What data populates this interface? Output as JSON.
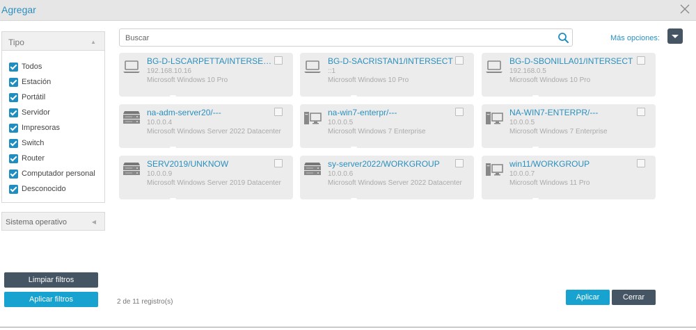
{
  "window": {
    "title": "Agregar"
  },
  "filters": {
    "tipo_label": "Tipo",
    "items": [
      {
        "label": "Todos",
        "checked": true
      },
      {
        "label": "Estación",
        "checked": true
      },
      {
        "label": "Portátil",
        "checked": true
      },
      {
        "label": "Servidor",
        "checked": true
      },
      {
        "label": "Impresoras",
        "checked": true
      },
      {
        "label": "Switch",
        "checked": true
      },
      {
        "label": "Router",
        "checked": true
      },
      {
        "label": "Computador personal",
        "checked": true
      },
      {
        "label": "Desconocido",
        "checked": true
      }
    ],
    "so_label": "Sistema operativo",
    "clear_label": "Limpiar filtros",
    "apply_label": "Aplicar filtros"
  },
  "search": {
    "placeholder": "Buscar"
  },
  "more_options_label": "Más opciones:",
  "devices": [
    {
      "name": "BG-D-LSCARPETTA/INTERSECT",
      "ip": "192.168.10.16",
      "os": "Microsoft Windows 10 Pro",
      "icon": "laptop-icon"
    },
    {
      "name": "BG-D-SACRISTAN1/INTERSECT",
      "ip": "::1",
      "os": "Microsoft Windows 10 Pro",
      "icon": "laptop-icon"
    },
    {
      "name": "BG-D-SBONILLA01/INTERSECT",
      "ip": "192.168.0.5",
      "os": "Microsoft Windows 10 Pro",
      "icon": "laptop-icon"
    },
    {
      "name": "na-adm-server20/---",
      "ip": "10.0.0.4",
      "os": "Microsoft Windows Server 2022 Datacenter",
      "icon": "server-icon"
    },
    {
      "name": "na-win7-enterpr/---",
      "ip": "10.0.0.5",
      "os": "Microsoft Windows 7 Enterprise",
      "icon": "desktop-icon"
    },
    {
      "name": "NA-WIN7-ENTERPR/---",
      "ip": "10.0.0.5",
      "os": "Microsoft Windows 7 Enterprise",
      "icon": "desktop-icon"
    },
    {
      "name": "SERV2019/UNKNOW",
      "ip": "10.0.0.9",
      "os": "Microsoft Windows Server 2019 Datacenter",
      "icon": "server-icon"
    },
    {
      "name": "sy-server2022/WORKGROUP",
      "ip": "10.0.0.6",
      "os": "Microsoft Windows Server 2022 Datacenter",
      "icon": "server-icon"
    },
    {
      "name": "win11/WORKGROUP",
      "ip": "10.0.0.7",
      "os": "Microsoft Windows 11 Pro",
      "icon": "desktop-icon"
    }
  ],
  "record_count": "2 de 11 registro(s)",
  "footer": {
    "apply_label": "Aplicar",
    "close_label": "Cerrar"
  }
}
